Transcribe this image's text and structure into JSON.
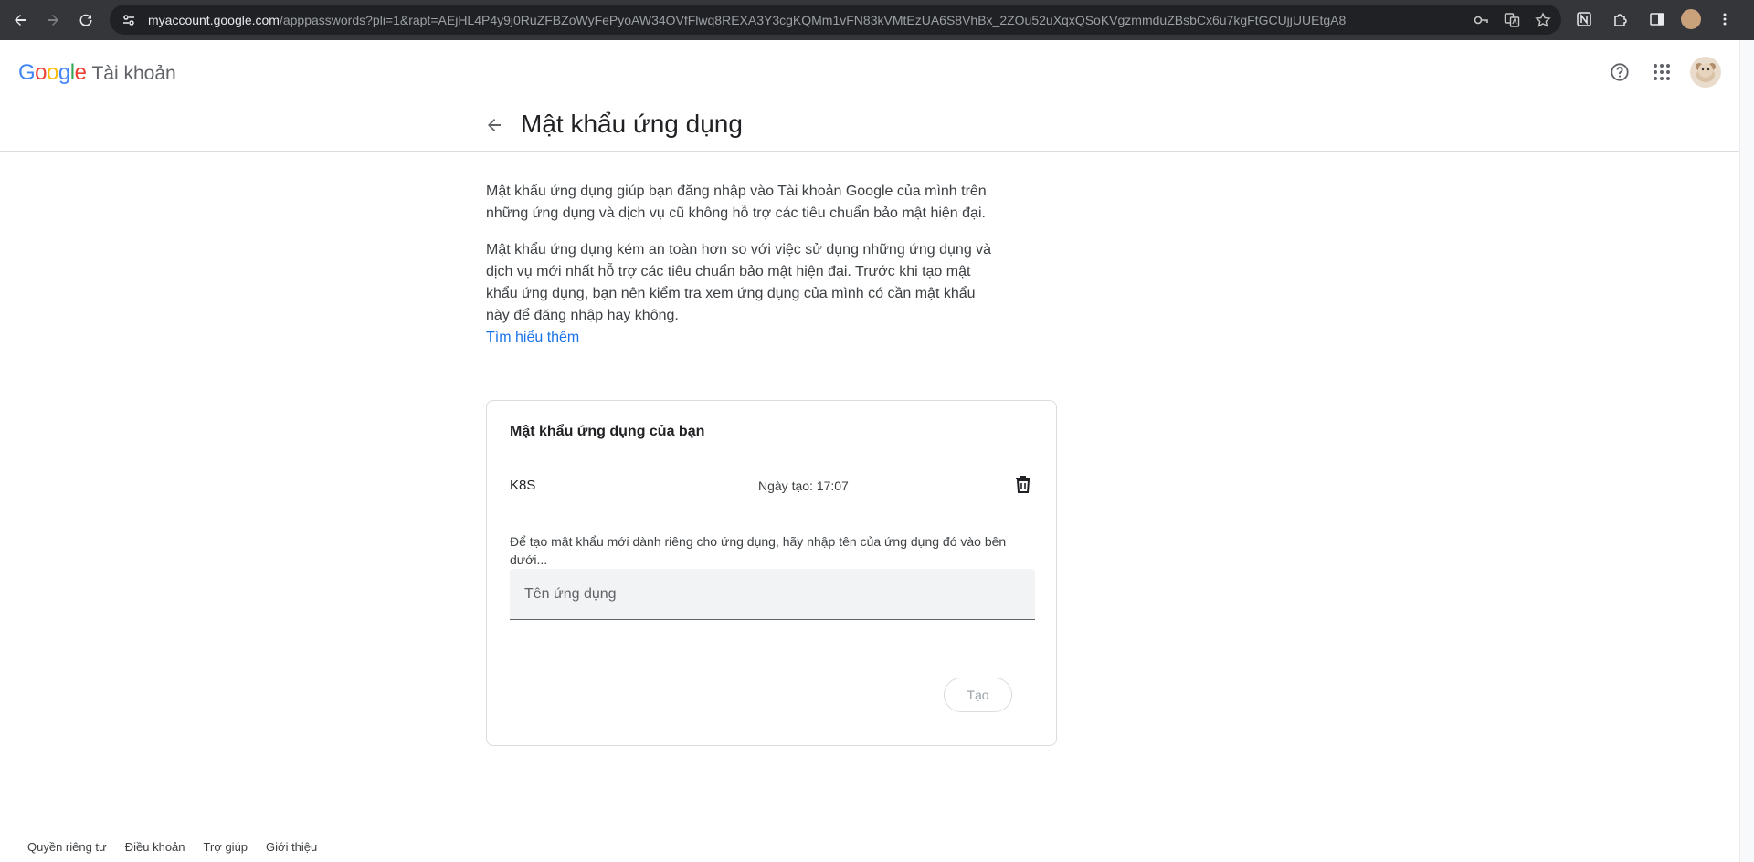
{
  "browser": {
    "url_host": "myaccount.google.com",
    "url_path": "/apppasswords?pli=1&rapt=AEjHL4P4y9j0RuZFBZoWyFePyoAW34OVfFlwq8REXA3Y3cgKQMm1vFN83kVMtEzUA6S8VhBx_2ZOu52uXqxQSoKVgzmmduZBsbCx6u7kgFtGCUjjUUEtgA8"
  },
  "header": {
    "logo_letters": [
      "G",
      "o",
      "o",
      "g",
      "l",
      "e"
    ],
    "logo_colors": [
      "#4285F4",
      "#EA4335",
      "#FBBC05",
      "#4285F4",
      "#34A853",
      "#EA4335"
    ],
    "product_name": "Tài khoản"
  },
  "page": {
    "title": "Mật khẩu ứng dụng",
    "paragraph1": "Mật khẩu ứng dụng giúp bạn đăng nhập vào Tài khoản Google của mình trên những ứng dụng và dịch vụ cũ không hỗ trợ các tiêu chuẩn bảo mật hiện đại.",
    "paragraph2": "Mật khẩu ứng dụng kém an toàn hơn so với việc sử dụng những ứng dụng và dịch vụ mới nhất hỗ trợ các tiêu chuẩn bảo mật hiện đại. Trước khi tạo mật khẩu ứng dụng, bạn nên kiểm tra xem ứng dụng của mình có cần mật khẩu này để đăng nhập hay không.",
    "learn_more": "Tìm hiểu thêm"
  },
  "card": {
    "title": "Mật khẩu ứng dụng của bạn",
    "passwords": [
      {
        "name": "K8S",
        "created": "Ngày tạo: 17:07"
      }
    ],
    "hint": "Để tạo mật khẩu mới dành riêng cho ứng dụng, hãy nhập tên của ứng dụng đó vào bên dưới...",
    "input_placeholder": "Tên ứng dụng",
    "input_value": "",
    "create_label": "Tạo"
  },
  "footer": {
    "links": [
      "Quyền riêng tư",
      "Điều khoản",
      "Trợ giúp",
      "Giới thiệu"
    ]
  }
}
